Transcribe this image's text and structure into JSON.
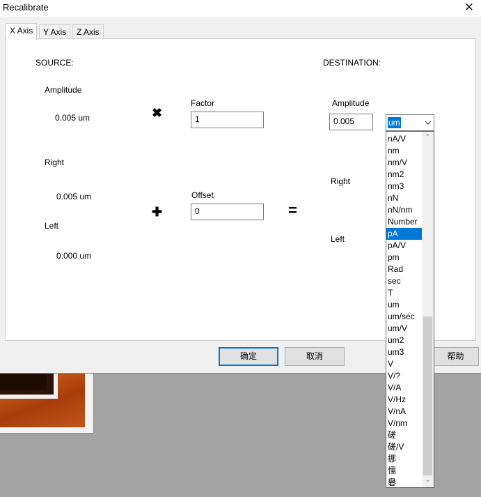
{
  "window": {
    "title": "Recalibrate",
    "close_glyph": "✕"
  },
  "tabs": [
    {
      "label": "X Axis",
      "active": true
    },
    {
      "label": "Y Axis",
      "active": false
    },
    {
      "label": "Z Axis",
      "active": false
    }
  ],
  "source": {
    "heading": "SOURCE:",
    "amplitude_label": "Amplitude",
    "amplitude_value": "0.005 um",
    "right_label": "Right",
    "right_value": "0.005 um",
    "left_label": "Left",
    "left_value": "0.000 um"
  },
  "operators": {
    "multiply": "✖",
    "plus": "✚",
    "equals": "="
  },
  "factor": {
    "label": "Factor",
    "value": "1"
  },
  "offset": {
    "label": "Offset",
    "value": "0"
  },
  "destination": {
    "heading": "DESTINATION:",
    "amplitude_label": "Amplitude",
    "amplitude_value": "0.005",
    "unit_selected": "um",
    "right_label": "Right",
    "left_label": "Left"
  },
  "buttons": {
    "ok": "确定",
    "cancel": "取消",
    "help": "帮助"
  },
  "unit_dropdown": {
    "items": [
      "nA/V",
      "nm",
      "nm/V",
      "nm2",
      "nm3",
      "nN",
      "nN/nm",
      "Number",
      "pA",
      "pA/V",
      "pm",
      "Rad",
      "sec",
      "T",
      "um",
      "um/sec",
      "um/V",
      "um2",
      "um3",
      "V",
      "V/?",
      "V/A",
      "V/Hz",
      "V/nA",
      "V/nm",
      "磋",
      "磋/V",
      "挪",
      "懦",
      "礜"
    ],
    "highlighted": "pA",
    "scroll_up_glyph": "⌃",
    "scroll_down_glyph": "⌄"
  },
  "colors": {
    "accent": "#0078d7",
    "dialog_bg": "#f0f0f0",
    "desktop_bg": "#a3a3a3"
  }
}
